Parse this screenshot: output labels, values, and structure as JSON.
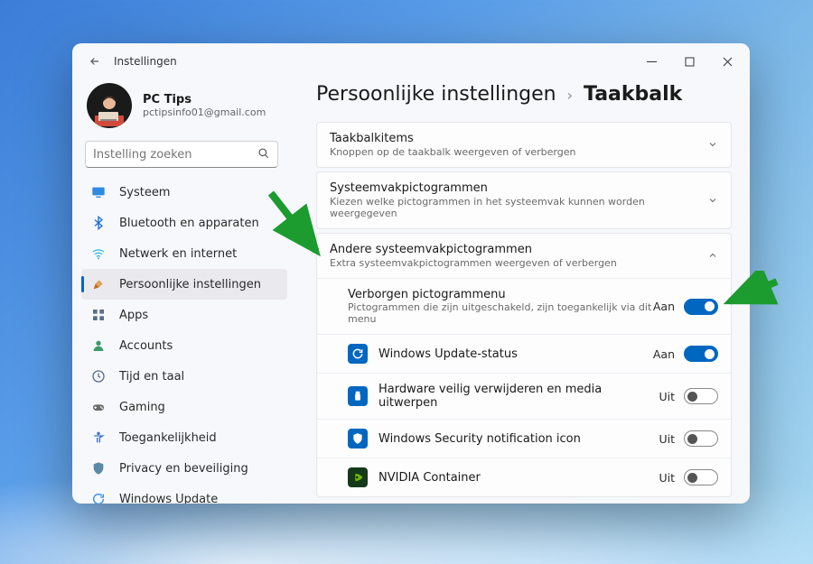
{
  "window": {
    "title": "Instellingen"
  },
  "profile": {
    "name": "PC Tips",
    "email": "pctipsinfo01@gmail.com"
  },
  "search": {
    "placeholder": "Instelling zoeken"
  },
  "nav": [
    {
      "icon": "system",
      "label": "Systeem",
      "color": "#2f8ae0"
    },
    {
      "icon": "bluetooth",
      "label": "Bluetooth en apparaten",
      "color": "#1f6fd4"
    },
    {
      "icon": "network",
      "label": "Netwerk en internet",
      "color": "#2fb9e0"
    },
    {
      "icon": "personalize",
      "label": "Persoonlijke instellingen",
      "color": "#c06a1f",
      "selected": true
    },
    {
      "icon": "apps",
      "label": "Apps",
      "color": "#5a6f88"
    },
    {
      "icon": "accounts",
      "label": "Accounts",
      "color": "#3a9a6a"
    },
    {
      "icon": "time",
      "label": "Tijd en taal",
      "color": "#5a6f88"
    },
    {
      "icon": "gaming",
      "label": "Gaming",
      "color": "#6a6a6a"
    },
    {
      "icon": "accessibility",
      "label": "Toegankelijkheid",
      "color": "#3a6fd0"
    },
    {
      "icon": "privacy",
      "label": "Privacy en beveiliging",
      "color": "#5a8aa8"
    },
    {
      "icon": "update",
      "label": "Windows Update",
      "color": "#2f8ae0"
    }
  ],
  "breadcrumb": {
    "parent": "Persoonlijke instellingen",
    "current": "Taakbalk"
  },
  "sections": [
    {
      "title": "Taakbalkitems",
      "sub": "Knoppen op de taakbalk weergeven of verbergen",
      "expanded": false
    },
    {
      "title": "Systeemvakpictogrammen",
      "sub": "Kiezen welke pictogrammen in het systeemvak kunnen worden weergegeven",
      "expanded": false
    },
    {
      "title": "Andere systeemvakpictogrammen",
      "sub": "Extra systeemvakpictogrammen weergeven of verbergen",
      "expanded": true
    }
  ],
  "toggles": [
    {
      "title": "Verborgen pictogrammenu",
      "sub": "Pictogrammen die zijn uitgeschakeld, zijn toegankelijk via dit menu",
      "state": "Aan",
      "on": true,
      "icon": null
    },
    {
      "title": "Windows Update-status",
      "state": "Aan",
      "on": true,
      "icon": "update-blue"
    },
    {
      "title": "Hardware veilig verwijderen en media uitwerpen",
      "state": "Uit",
      "on": false,
      "icon": "usb-blue"
    },
    {
      "title": "Windows Security notification icon",
      "state": "Uit",
      "on": false,
      "icon": "shield-blue"
    },
    {
      "title": "NVIDIA Container",
      "state": "Uit",
      "on": false,
      "icon": "nvidia"
    }
  ],
  "states": {
    "on": "Aan",
    "off": "Uit"
  }
}
